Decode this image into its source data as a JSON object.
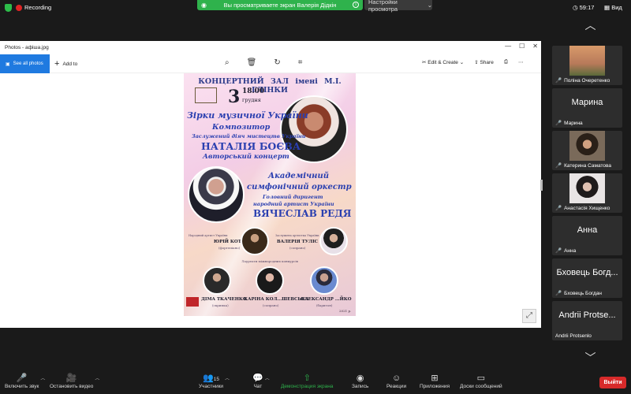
{
  "zoom_top": {
    "recording_label": "Recording",
    "share_banner": "Вы просматриваете экран Валерія Дідкін",
    "view_options": "Настройки просмотра",
    "timer": "59:17",
    "view_label": "Вид"
  },
  "photos_app": {
    "title": "Photos - афіша.jpg",
    "see_all": "See all photos",
    "add_to": "Add to",
    "edit_create": "Edit & Create",
    "share": "Share"
  },
  "poster": {
    "hall": "КОНЦЕРТНИЙ ЗАЛ імені М.І. ГЛІНКИ",
    "logo_text": "Запорізька обласна філармонія",
    "day": "3",
    "time": "18.00",
    "month": "грудня",
    "stars": "Зірки музичної України",
    "composer": "Композитор",
    "honored": "Заслужений діяч мистецтв України",
    "name_main": "НАТАЛІЯ БОЄВА",
    "concert": "Авторський концерт",
    "orch_1": "Академічний",
    "orch_2": "симфонічний оркестр",
    "chief": "Головний диригент",
    "people_artist": "народний артист України",
    "conductor": "ВЯЧЕСЛАВ РЕДЯ",
    "kot_caption": "Народний артист України",
    "kot_name": "ЮРІЙ КОТ",
    "kot_role": "(фортепіано)",
    "tulis_caption": "Заслужена артистка України",
    "tulis_name": "ВАЛЕРІЯ ТУЛІС",
    "tulis_role": "(сопрано)",
    "also": "Лауреати міжнародних конкурсів",
    "p1_name": "ДІМА ТКАЧЕНКО",
    "p1_role": "(скрипка)",
    "p2_name": "КАРІНА КОЛ...ШЕВСЬКА",
    "p2_role": "(сопрано)",
    "p3_name": "ОЛЕКСАНДР ...ЙКО",
    "p3_role": "(баритон)",
    "year": "2021 р."
  },
  "participants": [
    {
      "big": "",
      "name": "Поліна Очеретенко"
    },
    {
      "big": "Марина",
      "name": "Марина"
    },
    {
      "big": "",
      "name": "Катерина Саматова"
    },
    {
      "big": "",
      "name": "Анастасія Хищенко"
    },
    {
      "big": "Анна",
      "name": "Анна"
    },
    {
      "big": "Бховець Богд...",
      "name": "Бховець Богдан"
    },
    {
      "big": "Andrii Protse...",
      "name": "Andrii Protsenlo"
    }
  ],
  "bottom_bar": {
    "audio": "Включить звук",
    "video": "Остановить видео",
    "participants": "Участники",
    "participants_count": "15",
    "chat": "Чат",
    "share": "Демонстрация экрана",
    "record": "Запись",
    "reactions": "Реакции",
    "apps": "Приложения",
    "whiteboard": "Доски сообщений",
    "leave": "Выйти"
  },
  "colors": {
    "share_green": "#2fb24c",
    "photos_blue": "#1f7ae0",
    "leave_red": "#d72a2a",
    "poster_blue": "#2a3fb0"
  }
}
